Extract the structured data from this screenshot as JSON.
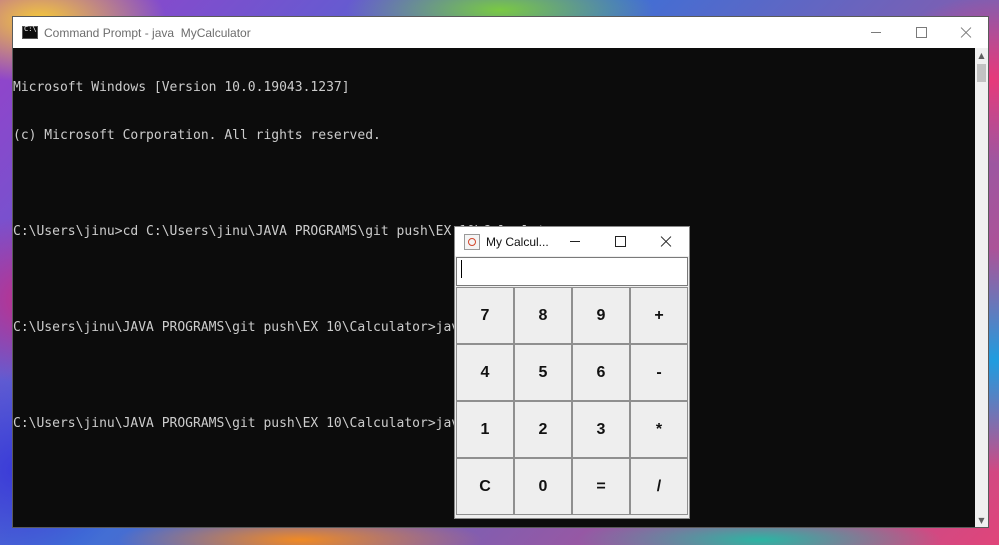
{
  "cmd_window": {
    "title": "Command Prompt - java  MyCalculator",
    "icon": "cmd-app-icon",
    "lines": [
      "Microsoft Windows [Version 10.0.19043.1237]",
      "(c) Microsoft Corporation. All rights reserved.",
      "",
      "C:\\Users\\jinu>cd C:\\Users\\jinu\\JAVA PROGRAMS\\git push\\EX 10\\Calculator",
      "",
      "C:\\Users\\jinu\\JAVA PROGRAMS\\git push\\EX 10\\Calculator>javac MyCalculator.java",
      "",
      "C:\\Users\\jinu\\JAVA PROGRAMS\\git push\\EX 10\\Calculator>java MyCalculator"
    ]
  },
  "calc_window": {
    "title": "My Calcul...",
    "icon": "java-icon",
    "display_value": "",
    "keys": [
      [
        "7",
        "8",
        "9",
        "+"
      ],
      [
        "4",
        "5",
        "6",
        "-"
      ],
      [
        "1",
        "2",
        "3",
        "*"
      ],
      [
        "C",
        "0",
        "=",
        "/"
      ]
    ]
  }
}
